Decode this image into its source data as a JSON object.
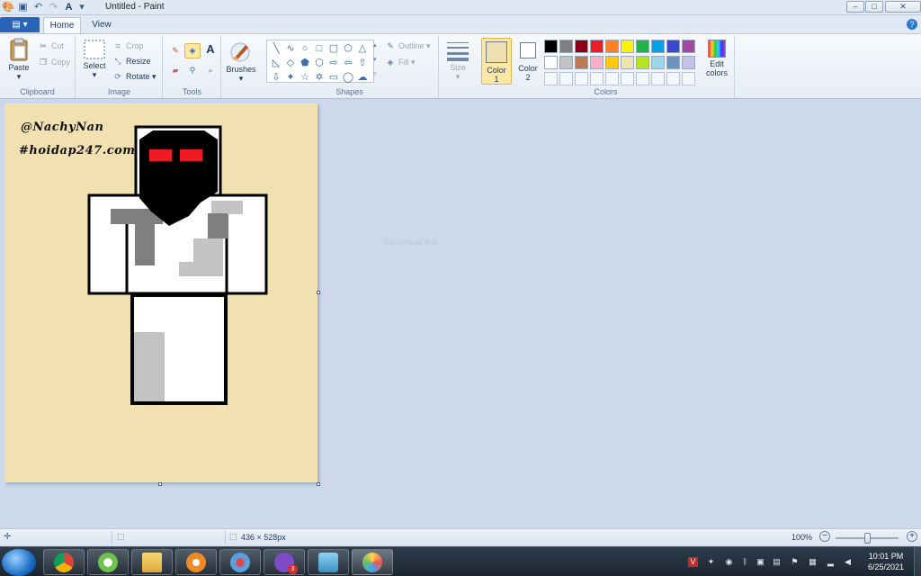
{
  "window": {
    "title": "Untitled - Paint",
    "controls": {
      "minimize": "–",
      "maximize": "□",
      "close": "✕"
    }
  },
  "ribbon": {
    "tabs": {
      "file": "▤ ▾",
      "home": "Home",
      "view": "View"
    },
    "clipboard": {
      "paste": "Paste",
      "cut": "Cut",
      "copy": "Copy",
      "label": "Clipboard"
    },
    "image": {
      "select": "Select",
      "crop": "Crop",
      "resize": "Resize",
      "rotate": "Rotate",
      "label": "Image"
    },
    "tools": {
      "label": "Tools"
    },
    "brushes": {
      "label": "Brushes"
    },
    "shapes": {
      "outline": "Outline",
      "fill": "Fill",
      "label": "Shapes"
    },
    "size": {
      "label": "Size"
    },
    "color1": {
      "label_line1": "Color",
      "label_line2": "1",
      "value": "#efe0b1"
    },
    "color2": {
      "label_line1": "Color",
      "label_line2": "2",
      "value": "#ffffff"
    },
    "colors": {
      "label": "Colors",
      "edit_line1": "Edit",
      "edit_line2": "colors",
      "row1": [
        "#000000",
        "#7f7f7f",
        "#880015",
        "#ed1c24",
        "#ff7f27",
        "#fff200",
        "#22b14c",
        "#00a2e8",
        "#3f48cc",
        "#a349a4"
      ],
      "row2": [
        "#ffffff",
        "#c3c3c3",
        "#b97a57",
        "#ffaec9",
        "#ffc90e",
        "#efe4b0",
        "#b5e61d",
        "#99d9ea",
        "#7092be",
        "#c8bfe7"
      ]
    }
  },
  "canvas": {
    "background": "#f2e1b0",
    "signature_line1": "@NachyNan",
    "signature_line2": "#hoidap247.com",
    "ghost_text": "Fill canvas first"
  },
  "statusbar": {
    "canvas_size": "436 × 528px",
    "zoom": "100%"
  },
  "taskbar": {
    "time": "10:01 PM",
    "date": "6/25/2021",
    "badge": "3"
  }
}
